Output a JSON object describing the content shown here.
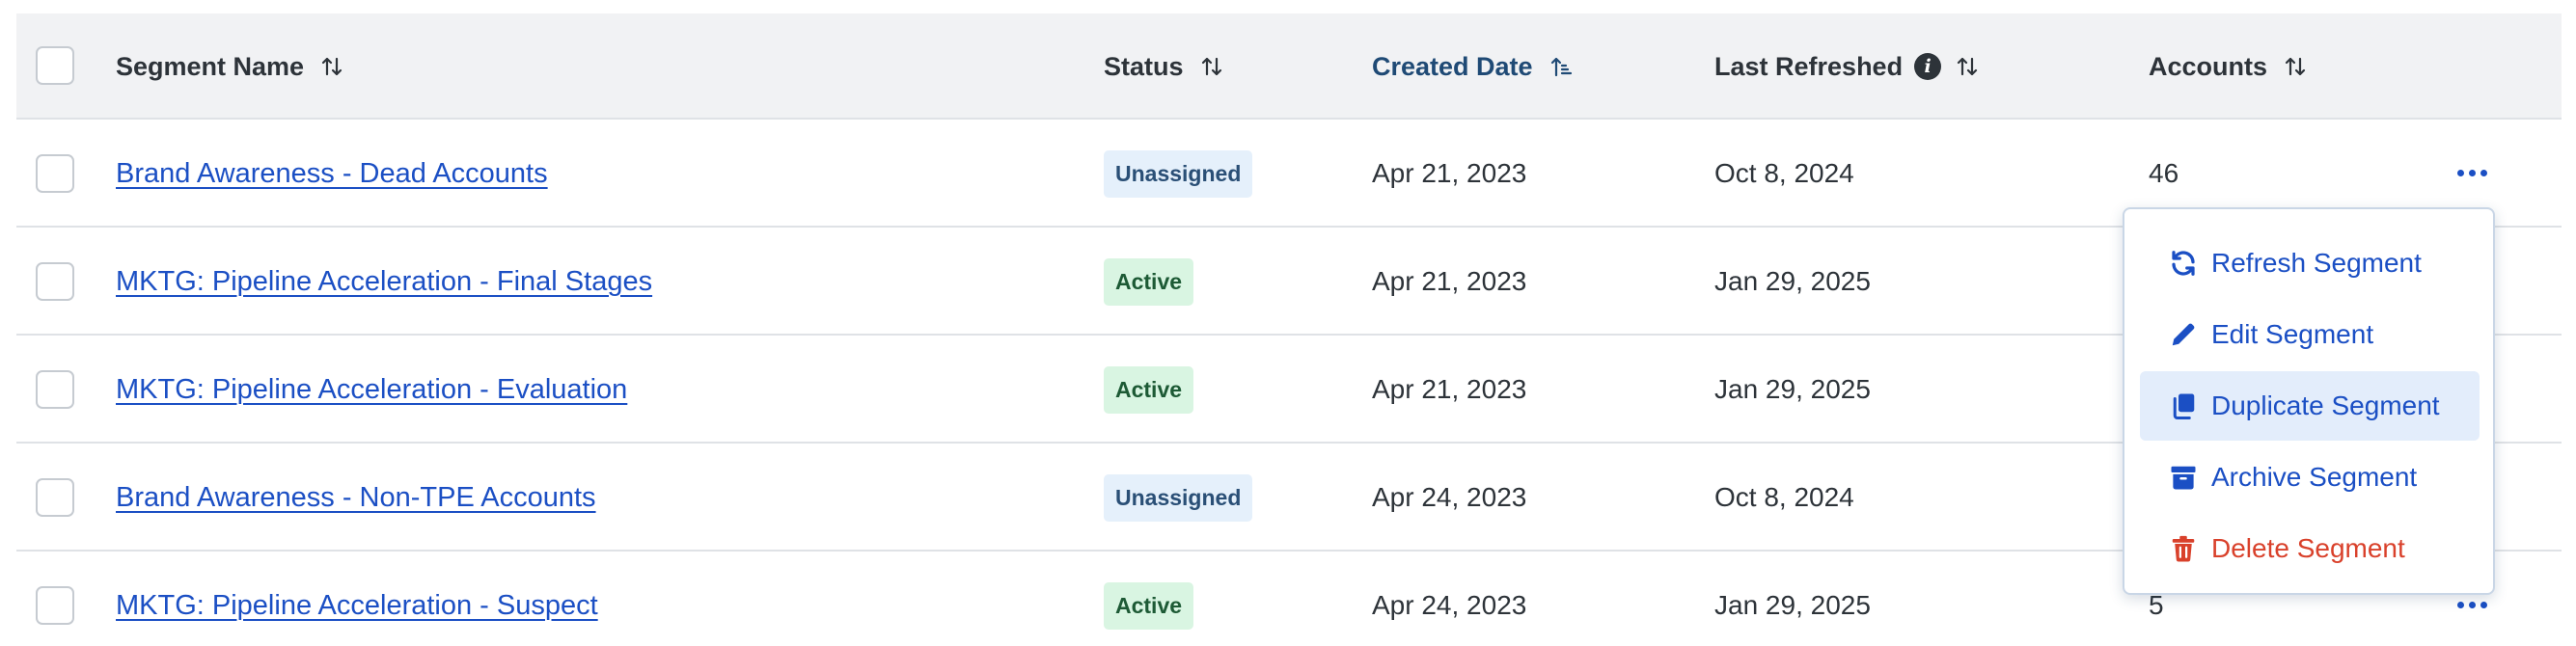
{
  "table": {
    "columns": [
      {
        "key": "name",
        "label": "Segment Name",
        "sort": "none"
      },
      {
        "key": "status",
        "label": "Status",
        "sort": "none"
      },
      {
        "key": "created",
        "label": "Created Date",
        "sort": "ascending",
        "highlighted": true
      },
      {
        "key": "refreshed",
        "label": "Last Refreshed",
        "sort": "none",
        "info_icon": true
      },
      {
        "key": "accounts",
        "label": "Accounts",
        "sort": "none"
      }
    ],
    "rows": [
      {
        "name": "Brand Awareness - Dead Accounts",
        "status": "Unassigned",
        "created": "Apr 21, 2023",
        "refreshed": "Oct 8, 2024",
        "accounts": "46"
      },
      {
        "name": "MKTG: Pipeline Acceleration - Final Stages",
        "status": "Active",
        "created": "Apr 21, 2023",
        "refreshed": "Jan 29, 2025",
        "accounts": ""
      },
      {
        "name": "MKTG: Pipeline Acceleration - Evaluation",
        "status": "Active",
        "created": "Apr 21, 2023",
        "refreshed": "Jan 29, 2025",
        "accounts": ""
      },
      {
        "name": "Brand Awareness - Non-TPE Accounts",
        "status": "Unassigned",
        "created": "Apr 24, 2023",
        "refreshed": "Oct 8, 2024",
        "accounts": ""
      },
      {
        "name": "MKTG: Pipeline Acceleration - Suspect",
        "status": "Active",
        "created": "Apr 24, 2023",
        "refreshed": "Jan 29, 2025",
        "accounts": "5"
      }
    ]
  },
  "menu": {
    "items": [
      {
        "label": "Refresh Segment",
        "icon": "refresh-icon"
      },
      {
        "label": "Edit Segment",
        "icon": "pencil-icon"
      },
      {
        "label": "Duplicate Segment",
        "icon": "copy-icon",
        "hovered": true
      },
      {
        "label": "Archive Segment",
        "icon": "archive-icon"
      },
      {
        "label": "Delete Segment",
        "icon": "trash-icon",
        "danger": true
      }
    ]
  },
  "colors": {
    "link": "#1b4fc4",
    "header_bg": "#f1f2f4",
    "sorted_header": "#1f4a75",
    "active_badge_bg": "#d9f5e2",
    "unassigned_badge_bg": "#e5f0fb",
    "danger": "#d9412b"
  }
}
